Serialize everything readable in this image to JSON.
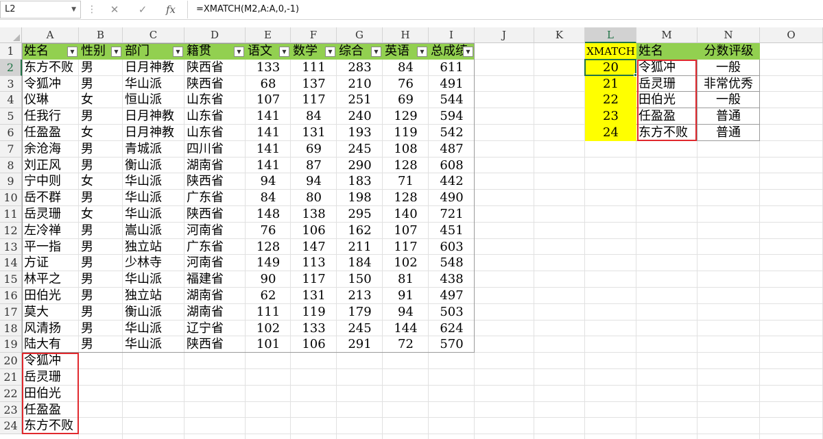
{
  "formula_bar": {
    "name_box": "L2",
    "separator": "⋮",
    "cancel_icon": "✕",
    "enter_icon": "✓",
    "fx_label": "fx",
    "formula": "=XMATCH(M2,A:A,0,-1)"
  },
  "columns": [
    "A",
    "B",
    "C",
    "D",
    "E",
    "F",
    "G",
    "H",
    "I",
    "J",
    "K",
    "L",
    "M",
    "N",
    "O"
  ],
  "rows": [
    "1",
    "2",
    "3",
    "4",
    "5",
    "6",
    "7",
    "8",
    "9",
    "10",
    "11",
    "12",
    "13",
    "14",
    "15",
    "16",
    "17",
    "18",
    "19",
    "20",
    "21",
    "22",
    "23",
    "24"
  ],
  "selected_column": "L",
  "selected_row": "2",
  "main_table": {
    "headers": [
      "姓名",
      "性别",
      "部门",
      "籍贯",
      "语文",
      "数学",
      "综合",
      "英语",
      "总成绩"
    ],
    "header_fill": "#92d050",
    "rows": [
      [
        "东方不败",
        "男",
        "日月神教",
        "陕西省",
        "133",
        "111",
        "283",
        "84",
        "611"
      ],
      [
        "令狐冲",
        "男",
        "华山派",
        "陕西省",
        "68",
        "137",
        "210",
        "76",
        "491"
      ],
      [
        "仪琳",
        "女",
        "恒山派",
        "山东省",
        "107",
        "117",
        "251",
        "69",
        "544"
      ],
      [
        "任我行",
        "男",
        "日月神教",
        "山东省",
        "141",
        "84",
        "240",
        "129",
        "594"
      ],
      [
        "任盈盈",
        "女",
        "日月神教",
        "山东省",
        "141",
        "131",
        "193",
        "119",
        "542"
      ],
      [
        "余沧海",
        "男",
        "青城派",
        "四川省",
        "141",
        "69",
        "245",
        "108",
        "487"
      ],
      [
        "刘正风",
        "男",
        "衡山派",
        "湖南省",
        "141",
        "87",
        "290",
        "128",
        "608"
      ],
      [
        "宁中则",
        "女",
        "华山派",
        "陕西省",
        "94",
        "94",
        "183",
        "71",
        "442"
      ],
      [
        "岳不群",
        "男",
        "华山派",
        "广东省",
        "84",
        "80",
        "198",
        "128",
        "490"
      ],
      [
        "岳灵珊",
        "女",
        "华山派",
        "陕西省",
        "148",
        "138",
        "295",
        "140",
        "721"
      ],
      [
        "左冷禅",
        "男",
        "嵩山派",
        "河南省",
        "76",
        "106",
        "162",
        "107",
        "451"
      ],
      [
        "平一指",
        "男",
        "独立站",
        "广东省",
        "128",
        "147",
        "211",
        "117",
        "603"
      ],
      [
        "方证",
        "男",
        "少林寺",
        "河南省",
        "149",
        "113",
        "184",
        "102",
        "548"
      ],
      [
        "林平之",
        "男",
        "华山派",
        "福建省",
        "90",
        "117",
        "150",
        "81",
        "438"
      ],
      [
        "田伯光",
        "男",
        "独立站",
        "湖南省",
        "62",
        "131",
        "213",
        "91",
        "497"
      ],
      [
        "莫大",
        "男",
        "衡山派",
        "湖南省",
        "111",
        "119",
        "179",
        "94",
        "503"
      ],
      [
        "风清扬",
        "男",
        "华山派",
        "辽宁省",
        "102",
        "133",
        "245",
        "144",
        "624"
      ],
      [
        "陆大有",
        "男",
        "华山派",
        "陕西省",
        "101",
        "106",
        "291",
        "72",
        "570"
      ]
    ],
    "extra_names": [
      "令狐冲",
      "岳灵珊",
      "田伯光",
      "任盈盈",
      "东方不败"
    ]
  },
  "lookup_table": {
    "headers": [
      "XMATCH",
      "姓名",
      "分数评级"
    ],
    "rows": [
      [
        "20",
        "令狐冲",
        "一般"
      ],
      [
        "21",
        "岳灵珊",
        "非常优秀"
      ],
      [
        "22",
        "田伯光",
        "一般"
      ],
      [
        "23",
        "任盈盈",
        "普通"
      ],
      [
        "24",
        "东方不败",
        "普通"
      ]
    ],
    "xmatch_fill": "#ffff00",
    "header_fill": "#92d050"
  },
  "highlight_color": "#e0282d",
  "selection_color": "#217346"
}
